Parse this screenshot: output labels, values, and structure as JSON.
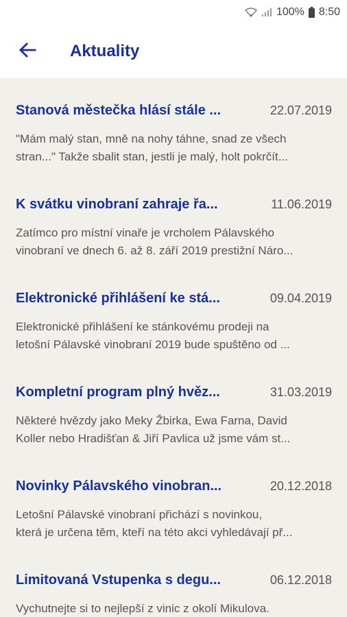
{
  "status_bar": {
    "battery": "100%",
    "time": "8:50",
    "icons": [
      "wifi-icon",
      "signal-icon",
      "battery-icon"
    ]
  },
  "app_bar": {
    "title": "Aktuality",
    "back_icon": "arrow-left-icon"
  },
  "colors": {
    "accent": "#1a3296",
    "background": "#f2f0eb",
    "text_secondary": "#555555"
  },
  "news": [
    {
      "title": "Stanová městečka hlásí stále ...",
      "date": "22.07.2019",
      "excerpt_lines": [
        " \"Mám malý stan, mně na nohy táhne, snad ze všech",
        "stran...\" Takže sbalit stan, jestli je malý, holt pokrčít..."
      ]
    },
    {
      "title": "K svátku vinobraní zahraje řa...",
      "date": "11.06.2019",
      "excerpt_lines": [
        "Zatímco pro místní vinaře je vrcholem Pálavského",
        "vinobraní ve dnech 6. až 8. září 2019 prestižní Náro..."
      ]
    },
    {
      "title": "Elektronické přihlášení ke stá...",
      "date": "09.04.2019",
      "excerpt_lines": [
        "Elektronické přihlášení ke stánkovému prodeji na",
        "letošní Pálavské vinobraní 2019 bude spuštěno od ..."
      ]
    },
    {
      "title": "Kompletní program plný hvěz...",
      "date": "31.03.2019",
      "excerpt_lines": [
        "Některé hvězdy jako Meky Žbirka, Ewa Farna, David",
        "Koller nebo Hradišťan & Jiří Pavlica už jsme vám st..."
      ]
    },
    {
      "title": "Novinky Pálavského vinobran...",
      "date": "20.12.2018",
      "excerpt_lines": [
        "Letošní Pálavské vinobraní přichází s novinkou,",
        "která je určena těm, kteří na této akci vyhledávají př..."
      ]
    },
    {
      "title": "Limitovaná Vstupenka s degu...",
      "date": "06.12.2018",
      "excerpt_lines": [
        "Vychutnejte si to nejlepší z vinic z okolí Mikulova.",
        ""
      ]
    }
  ]
}
